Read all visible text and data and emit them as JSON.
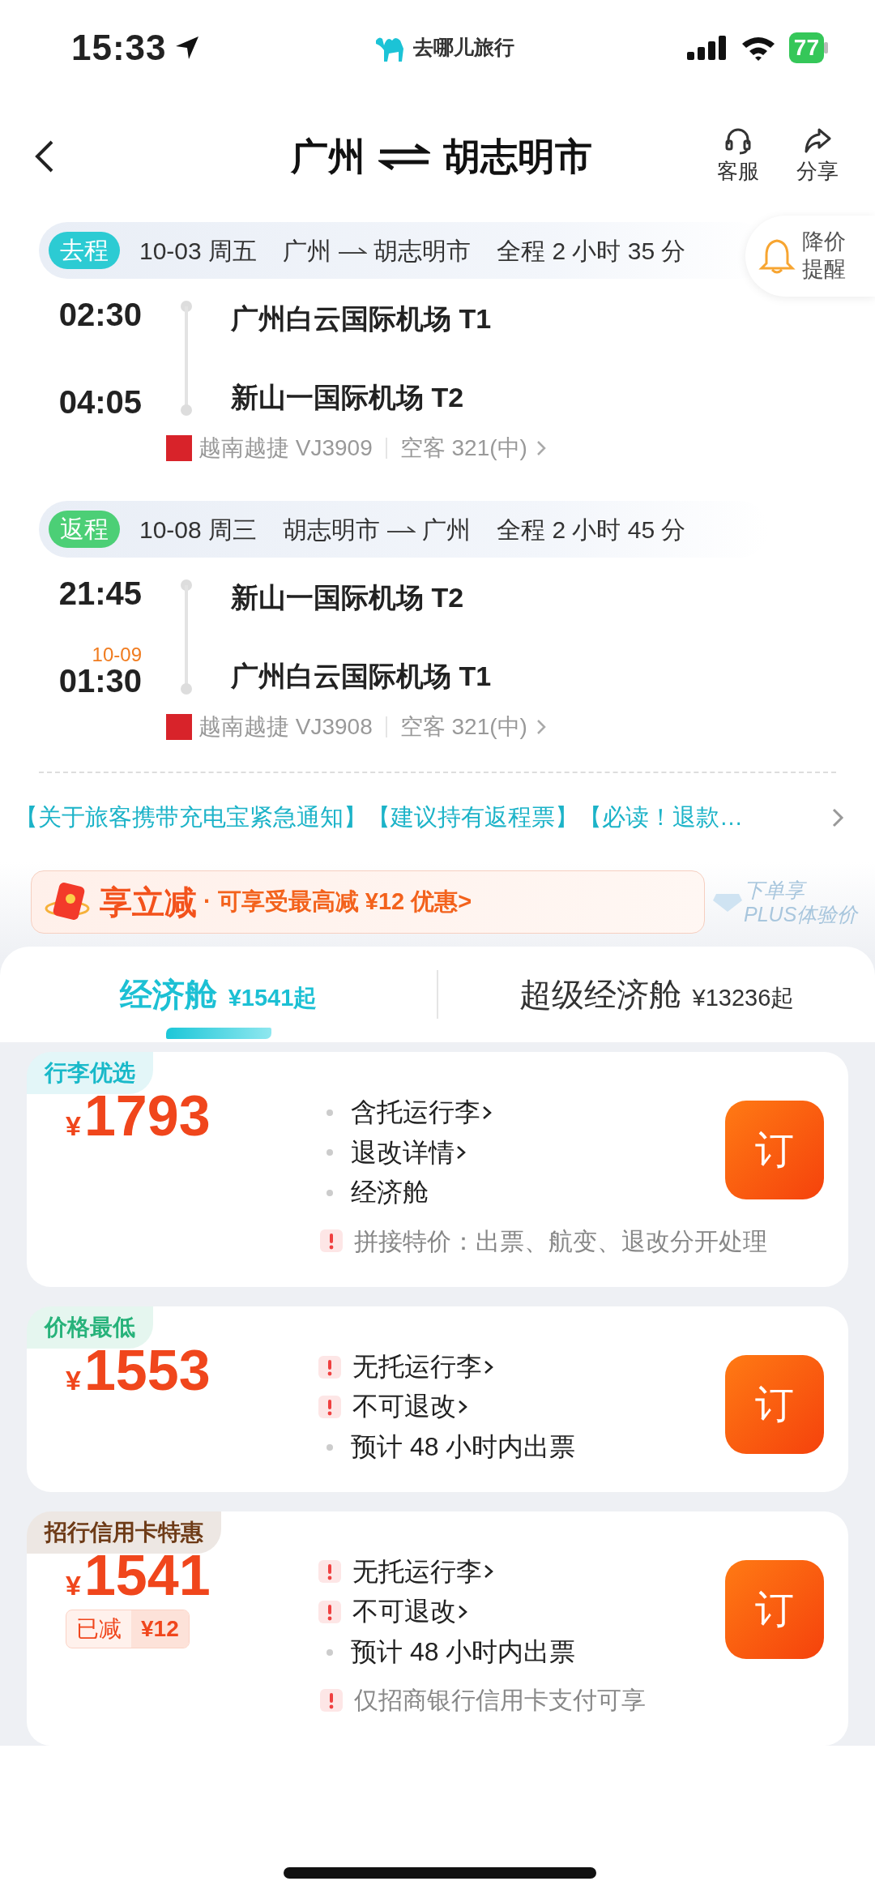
{
  "status_bar": {
    "time": "15:33",
    "app": "去哪儿旅行",
    "battery": "77"
  },
  "nav": {
    "from": "广州",
    "to": "胡志明市",
    "actions": [
      {
        "label": "客服",
        "kind": "service"
      },
      {
        "label": "分享",
        "kind": "share"
      }
    ]
  },
  "price_alert": {
    "label": "降价提醒"
  },
  "segments": [
    {
      "tag": "去程",
      "color": "#2ccbd3",
      "date": "10-03 周五",
      "from": "广州",
      "to": "胡志明市",
      "duration": "全程 2 小时 35 分",
      "dep_time": "02:30",
      "arr_time": "04:05",
      "dep_airport": "广州白云国际机场 T1",
      "arr_airport": "新山一国际机场 T2",
      "airline": "越南越捷 VJ3909",
      "aircraft": "空客 321(中)"
    },
    {
      "tag": "返程",
      "color": "#4ccf76",
      "date": "10-08 周三",
      "from": "胡志明市",
      "to": "广州",
      "duration": "全程 2 小时 45 分",
      "dep_time": "21:45",
      "arr_time": "01:30",
      "arr_date": "10-09",
      "dep_airport": "新山一国际机场 T2",
      "arr_airport": "广州白云国际机场 T1",
      "airline": "越南越捷 VJ3908",
      "aircraft": "空客 321(中)"
    }
  ],
  "notice": "【关于旅客携带充电宝紧急通知】【建议持有返程票】【必读！退款…",
  "promo": {
    "title": "享立减",
    "text": "· 可享受最高减 ¥12 优惠>",
    "plus": [
      "下单享",
      "PLUS体验价"
    ]
  },
  "cabin_tabs": [
    {
      "name": "经济舱",
      "price": "¥1541起",
      "selected": true
    },
    {
      "name": "超级经济舱",
      "price": "¥13236起",
      "selected": false
    }
  ],
  "fares": [
    {
      "tag": "行李优选",
      "color": "#19b9c9",
      "currency": "¥",
      "price": "1793",
      "features": [
        {
          "kind": "dot",
          "text": "含托运行李",
          "link": true
        },
        {
          "kind": "dot",
          "text": "退改详情",
          "link": true
        },
        {
          "kind": "dot",
          "text": "经济舱",
          "link": false
        }
      ],
      "note": "拼接特价：出票、航变、退改分开处理",
      "button": "订"
    },
    {
      "tag": "价格最低",
      "color": "#27b27a",
      "currency": "¥",
      "price": "1553",
      "features": [
        {
          "kind": "warn",
          "text": "无托运行李",
          "link": true
        },
        {
          "kind": "warn",
          "text": "不可退改",
          "link": true
        },
        {
          "kind": "dot",
          "text": "预计 48 小时内出票",
          "link": false
        }
      ],
      "button": "订"
    },
    {
      "tag": "招行信用卡特惠",
      "color": "#6e3b17",
      "currency": "¥",
      "price": "1541",
      "discount": {
        "label": "已减",
        "amount": "¥12"
      },
      "features": [
        {
          "kind": "warn",
          "text": "无托运行李",
          "link": true
        },
        {
          "kind": "warn",
          "text": "不可退改",
          "link": true
        },
        {
          "kind": "dot",
          "text": "预计 48 小时内出票",
          "link": false
        }
      ],
      "note": "仅招商银行信用卡支付可享",
      "button": "订"
    }
  ]
}
